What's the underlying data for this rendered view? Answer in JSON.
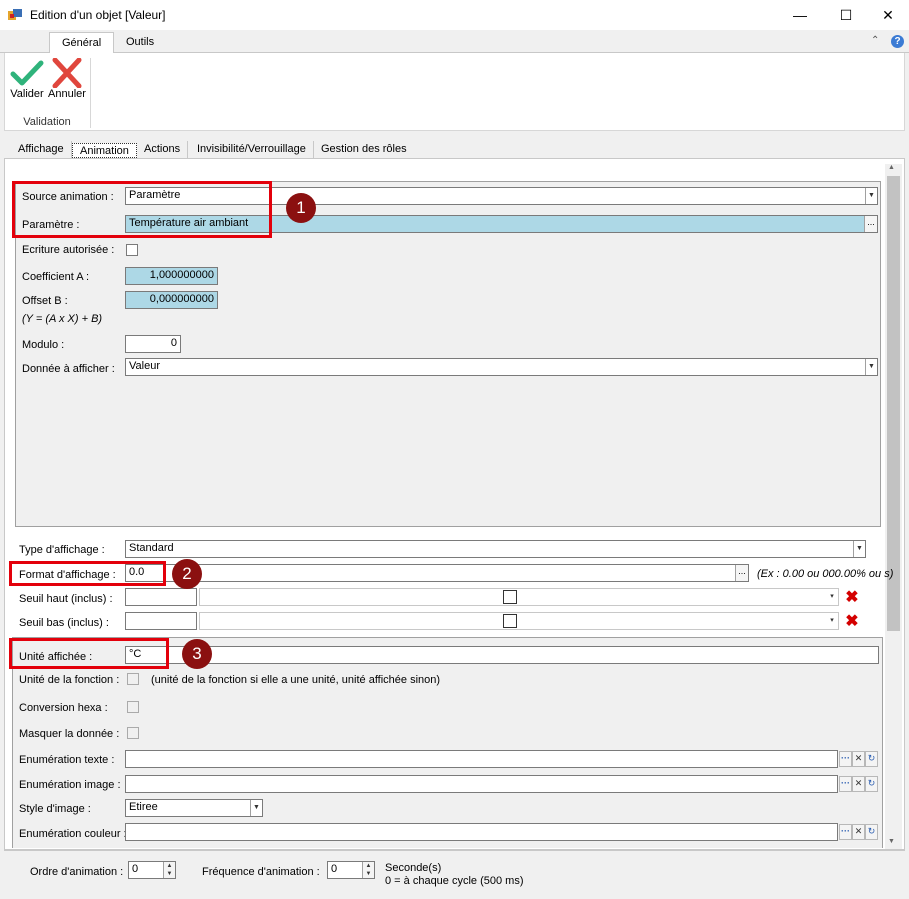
{
  "window": {
    "title": "Edition d'un objet [Valeur]",
    "minimize": "—",
    "maximize": "☐",
    "close": "✕"
  },
  "ribbon": {
    "tabs": [
      {
        "label": "Général"
      },
      {
        "label": "Outils"
      }
    ],
    "valider": "Valider",
    "annuler": "Annuler",
    "group_label": "Validation",
    "collapse": "⌃",
    "help": "?"
  },
  "tabs": [
    {
      "label": "Affichage"
    },
    {
      "label": "Animation"
    },
    {
      "label": "Actions"
    },
    {
      "label": "Invisibilité/Verrouillage"
    },
    {
      "label": "Gestion des rôles"
    }
  ],
  "animation": {
    "source_label": "Source animation :",
    "source_value": "Paramètre",
    "parametre_label": "Paramètre :",
    "parametre_value": "Température air ambiant",
    "ecriture_label": "Ecriture autorisée :",
    "coef_label": "Coefficient A :",
    "coef_value": "1,000000000",
    "offset_label": "Offset B :",
    "offset_value": "0,000000000",
    "formula": "(Y = (A x X) + B)",
    "modulo_label": "Modulo :",
    "modulo_value": "0",
    "donnee_label": "Donnée à afficher :",
    "donnee_value": "Valeur"
  },
  "display": {
    "type_label": "Type d'affichage :",
    "type_value": "Standard",
    "format_label": "Format d'affichage :",
    "format_value": "0.0",
    "format_hint": "(Ex : 0.00 ou 000.00% ou s)",
    "seuil_haut_label": "Seuil haut (inclus) :",
    "seuil_bas_label": "Seuil bas (inclus) :",
    "unite_label": "Unité affichée :",
    "unite_value": "°C",
    "unite_fonction_label": "Unité de la fonction :",
    "unite_fonction_hint": "(unité de la fonction si elle a une unité, unité affichée sinon)",
    "conversion_label": "Conversion hexa :",
    "masquer_label": "Masquer la donnée :",
    "enum_texte_label": "Enumération texte :",
    "enum_image_label": "Enumération image :",
    "style_image_label": "Style d'image :",
    "style_image_value": "Etiree",
    "enum_couleur_label": "Enumération couleur :"
  },
  "badges": [
    "1",
    "2",
    "3"
  ],
  "bottom": {
    "ordre_label": "Ordre d'animation :",
    "ordre_value": "0",
    "freq_label": "Fréquence d'animation :",
    "freq_value": "0",
    "seconde": "Seconde(s)",
    "cycle_hint": "0 = à chaque cycle (500 ms)"
  },
  "colors": {
    "highlight_red": "#e3000b",
    "badge": "#8b1010",
    "param_blue": "#add8e6",
    "valider_green": "#2fb37b",
    "annuler_red": "#e0463d"
  }
}
